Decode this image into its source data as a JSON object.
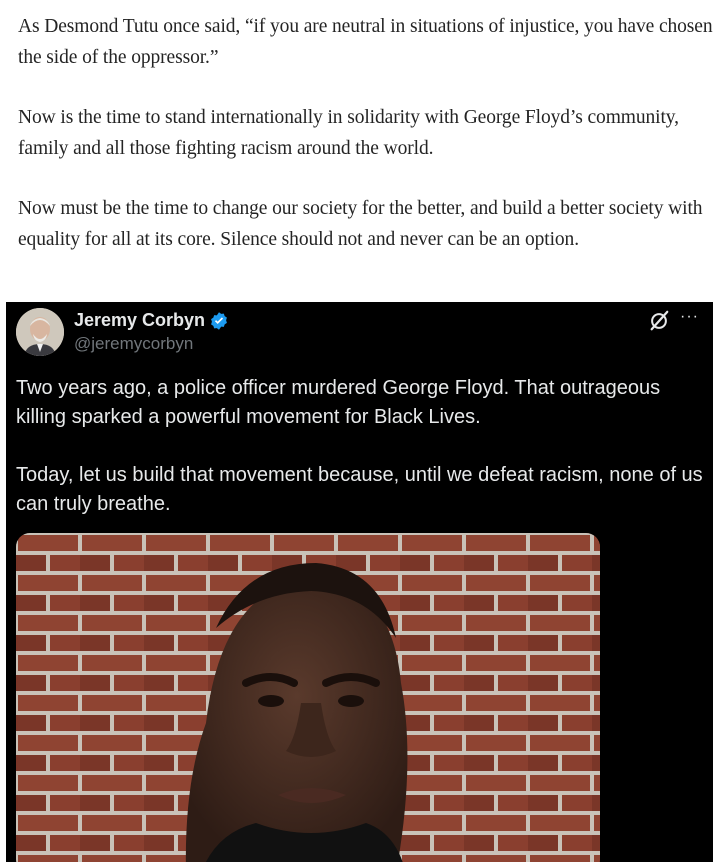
{
  "article": {
    "paragraphs": [
      "As Desmond Tutu once said, “if you are neutral in situations of injustice, you have chosen the side of the oppressor.”",
      "Now is the time to stand internationally in solidarity with George Floyd’s community, family and all those fighting racism around the world.",
      "Now must be the time to change our society for the better, and build a better society with equality for all at its core. Silence should not and never can be an option."
    ]
  },
  "tweet": {
    "author_name": "Jeremy Corbyn",
    "handle": "@jeremycorbyn",
    "more_label": "···",
    "text_paragraphs": [
      "Two years ago, a police officer murdered George Floyd.  That outrageous killing sparked a powerful movement for Black Lives.",
      "Today, let us build that movement because, until we defeat racism, none of us can truly breathe."
    ],
    "icons": {
      "verified": "verified-badge-icon",
      "logo": "x-logo-icon",
      "more": "more-options-icon"
    },
    "colors": {
      "background": "#000000",
      "text": "#e7e9ea",
      "secondary": "#71767b",
      "verified": "#1d9bf0"
    }
  }
}
